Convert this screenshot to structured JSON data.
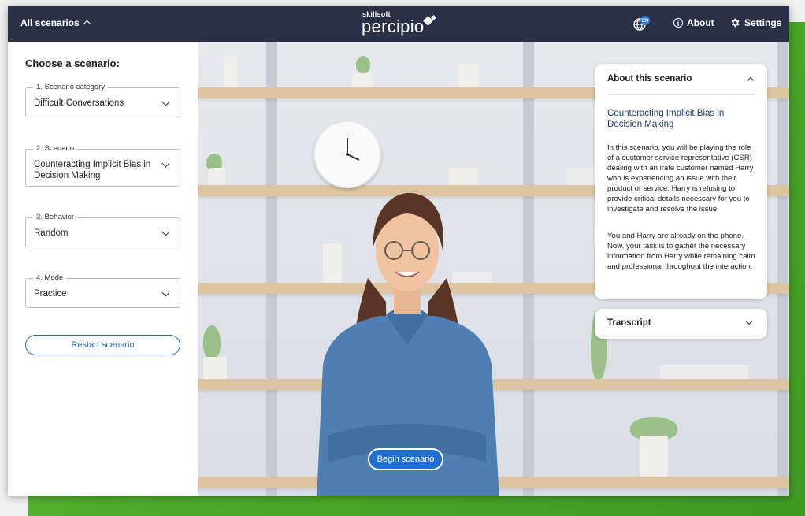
{
  "topbar": {
    "scenarios_toggle": "All scenarios",
    "logo_small": "skillsoft",
    "logo_big": "percipio",
    "language": "EN",
    "about": "About",
    "settings": "Settings"
  },
  "left_panel": {
    "heading": "Choose a scenario:",
    "fields": [
      {
        "label": "1. Scenario category",
        "value": "Difficult Conversations"
      },
      {
        "label": "2. Scenario",
        "value": "Counteracting Implicit Bias in Decision Making"
      },
      {
        "label": "3. Behavior",
        "value": "Random"
      },
      {
        "label": "4. Mode",
        "value": "Practice"
      }
    ],
    "restart_button": "Restart scenario"
  },
  "scene": {
    "begin_button": "Begin scenario"
  },
  "about_card": {
    "header": "About this scenario",
    "title": "Counteracting Implicit Bias in Decision Making",
    "paragraphs": [
      "In this scenario, you will be playing the role of a customer service representative (CSR) dealing with an irate customer named Harry who is experiencing an issue with their product or service. Harry is refusing to provide critical details necessary for you to investigate and resolve the issue.",
      "You and Harry are already on the phone. Now, your task is to gather the necessary information from Harry while remaining calm and professional throughout the interaction."
    ]
  },
  "transcript": {
    "header": "Transcript"
  },
  "colors": {
    "topbar": "#2a3147",
    "accent": "#2b6cb0",
    "begin_button": "#1f6fd1",
    "frame_green": "#4eaa2a"
  }
}
